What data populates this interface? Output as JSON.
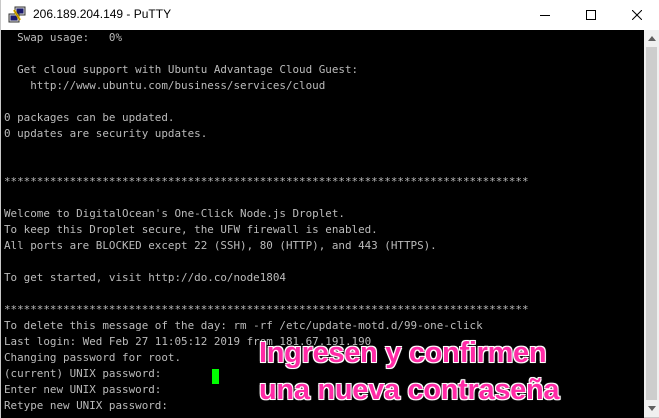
{
  "window": {
    "title": "206.189.204.149 - PuTTY",
    "app_icon": "putty-icon",
    "controls": [
      "minimize-icon",
      "maximize-icon",
      "close-icon"
    ]
  },
  "terminal": {
    "lines": [
      "  Swap usage:   0%",
      "",
      "  Get cloud support with Ubuntu Advantage Cloud Guest:",
      "    http://www.ubuntu.com/business/services/cloud",
      "",
      "0 packages can be updated.",
      "0 updates are security updates.",
      "",
      "",
      "",
      "",
      "",
      "Welcome to DigitalOcean's One-Click Node.js Droplet.",
      "To keep this Droplet secure, the UFW firewall is enabled.",
      "All ports are BLOCKED except 22 (SSH), 80 (HTTP), and 443 (HTTPS).",
      "",
      "To get started, visit http://do.co/node1804",
      "",
      "",
      "To delete this message of the day: rm -rf /etc/update-motd.d/99-one-click",
      "Last login: Wed Feb 27 11:05:12 2019 from 181.67.191.190",
      "Changing password for root.",
      "(current) UNIX password:",
      "Enter new UNIX password:",
      "Retype new UNIX password: "
    ],
    "separator_lines": [
      "********************************************************************************",
      "********************************************************************************"
    ],
    "foreground_color": "#bbbbbb",
    "background_color": "#000000",
    "cursor_color": "#00ff00"
  },
  "overlay": {
    "line1": "Ingresen y confirmen",
    "line2": "una nueva contraseña",
    "color": "#ff2ba6"
  }
}
